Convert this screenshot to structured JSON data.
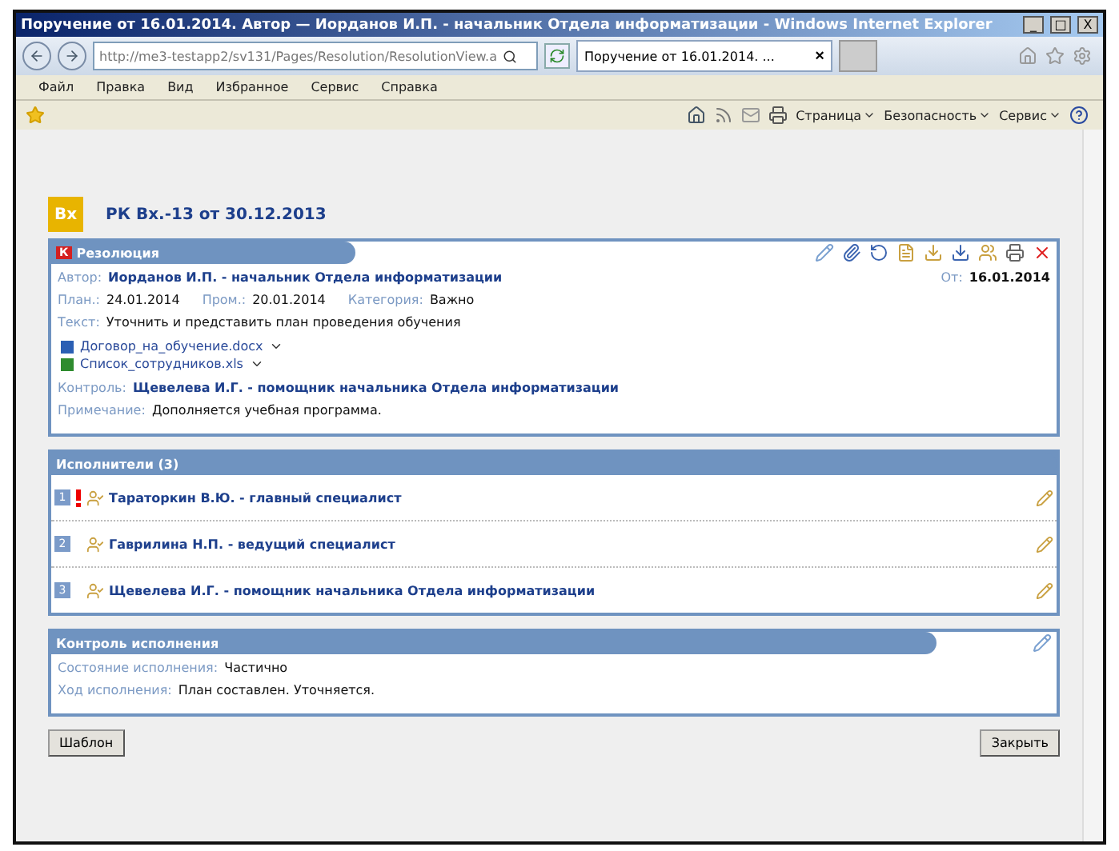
{
  "window": {
    "title": "Поручение от 16.01.2014. Автор — Иорданов И.П. - начальник Отдела информатизации - Windows Internet Explorer",
    "controls": [
      "_",
      "□",
      "X"
    ]
  },
  "address_bar": {
    "url": "http://me3-testapp2/sv131/Pages/Resolution/ResolutionView.a",
    "tab_title": "Поручение от 16.01.2014. ...",
    "tab_close": "×"
  },
  "menu": [
    "Файл",
    "Правка",
    "Вид",
    "Избранное",
    "Сервис",
    "Справка"
  ],
  "command_bar": [
    "Страница",
    "Безопасность",
    "Сервис"
  ],
  "document": {
    "badge": "Вх",
    "title": "РК Вх.-13 от 30.12.2013"
  },
  "resolution": {
    "badge": "К",
    "header": "Резолюция",
    "from_label": "От:",
    "from_value": "16.01.2014",
    "author": {
      "label": "Автор:",
      "value": "Иорданов И.П. - начальник Отдела информатизации"
    },
    "dates": [
      {
        "label": "План.:",
        "value": "24.01.2014"
      },
      {
        "label": "Пром.:",
        "value": "20.01.2014"
      },
      {
        "label": "Категория:",
        "value": "Важно"
      }
    ],
    "text": {
      "label": "Текст:",
      "value": "Уточнить и представить план проведения обучения"
    },
    "attachments": [
      {
        "kind": "word",
        "name": "Договор_на_обучение.docx"
      },
      {
        "kind": "excel",
        "name": "Список_сотрудников.xls"
      }
    ],
    "control": {
      "label": "Контроль:",
      "value": "Щевелева И.Г. - помощник начальника Отдела информатизации"
    },
    "note": {
      "label": "Примечание:",
      "value": "Дополняется учебная программа."
    }
  },
  "executors": {
    "header": "Исполнители (3)",
    "items": [
      {
        "number": "1",
        "urgent": true,
        "name": "Тараторкин В.Ю. - главный специалист"
      },
      {
        "number": "2",
        "urgent": false,
        "name": "Гаврилина Н.П. - ведущий специалист"
      },
      {
        "number": "3",
        "urgent": false,
        "name": "Щевелева И.Г. - помощник начальника Отдела информатизации"
      }
    ]
  },
  "execution_control": {
    "header": "Контроль исполнения",
    "rows": [
      {
        "label": "Состояние исполнения:",
        "value": "Частично"
      },
      {
        "label": "Ход исполнения:",
        "value": "План составлен. Уточняется."
      }
    ]
  },
  "buttons": [
    "Шаблон",
    "Закрыть"
  ]
}
